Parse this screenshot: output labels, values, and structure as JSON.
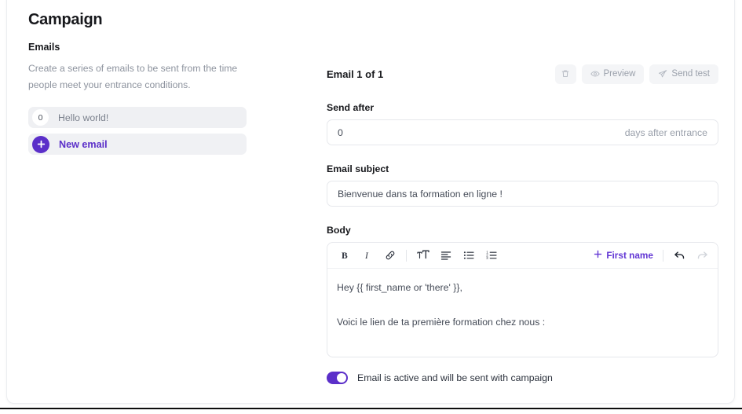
{
  "page": {
    "title": "Campaign"
  },
  "sidebar": {
    "section_title": "Emails",
    "section_description": "Create a series of emails to be sent from the time people meet your entrance conditions.",
    "emails": [
      {
        "badge": "0",
        "label": "Hello world!"
      }
    ],
    "new_email": {
      "label": "New email",
      "icon": "plus-icon"
    }
  },
  "editor_panel": {
    "title": "Email 1 of 1",
    "actions": [
      {
        "id": "delete",
        "label": "",
        "icon": "trash-icon"
      },
      {
        "id": "preview",
        "label": "Preview",
        "icon": "eye-icon"
      },
      {
        "id": "send-test",
        "label": "Send test",
        "icon": "paper-plane-icon"
      }
    ],
    "send_after": {
      "label": "Send after",
      "value": "0",
      "placeholder": "0",
      "suffix": "days after entrance"
    },
    "email_subject": {
      "label": "Email subject",
      "value": "Bienvenue dans ta formation en ligne !",
      "placeholder": "Email subject"
    },
    "body": {
      "label": "Body",
      "toolbar": {
        "bold": "B",
        "italic": "I",
        "link_icon": "link-icon",
        "heading_icon": "text-size-icon",
        "blockquote_icon": "align-left-list-icon",
        "bullet_list_icon": "bullet-list-icon",
        "ordered_list_icon": "numbered-list-icon",
        "merge_tag_label": "First name",
        "merge_tag_icon": "plus-icon",
        "undo_icon": "undo-arrow-icon",
        "redo_icon": "redo-arrow-icon"
      },
      "paragraphs": [
        "Hey {{ first_name or 'there' }},",
        "Voici le lien de ta première formation chez nous :"
      ]
    },
    "active_toggle": {
      "label": "Email is active and will be sent with campaign",
      "state": "on"
    }
  },
  "colors": {
    "accent_purple": "#5b2fc9",
    "link_purple": "#6236d4",
    "text_dark": "#17181c",
    "text_muted": "#8d939e",
    "row_bg": "#f0f1f4",
    "border": "#e6e8ec"
  }
}
